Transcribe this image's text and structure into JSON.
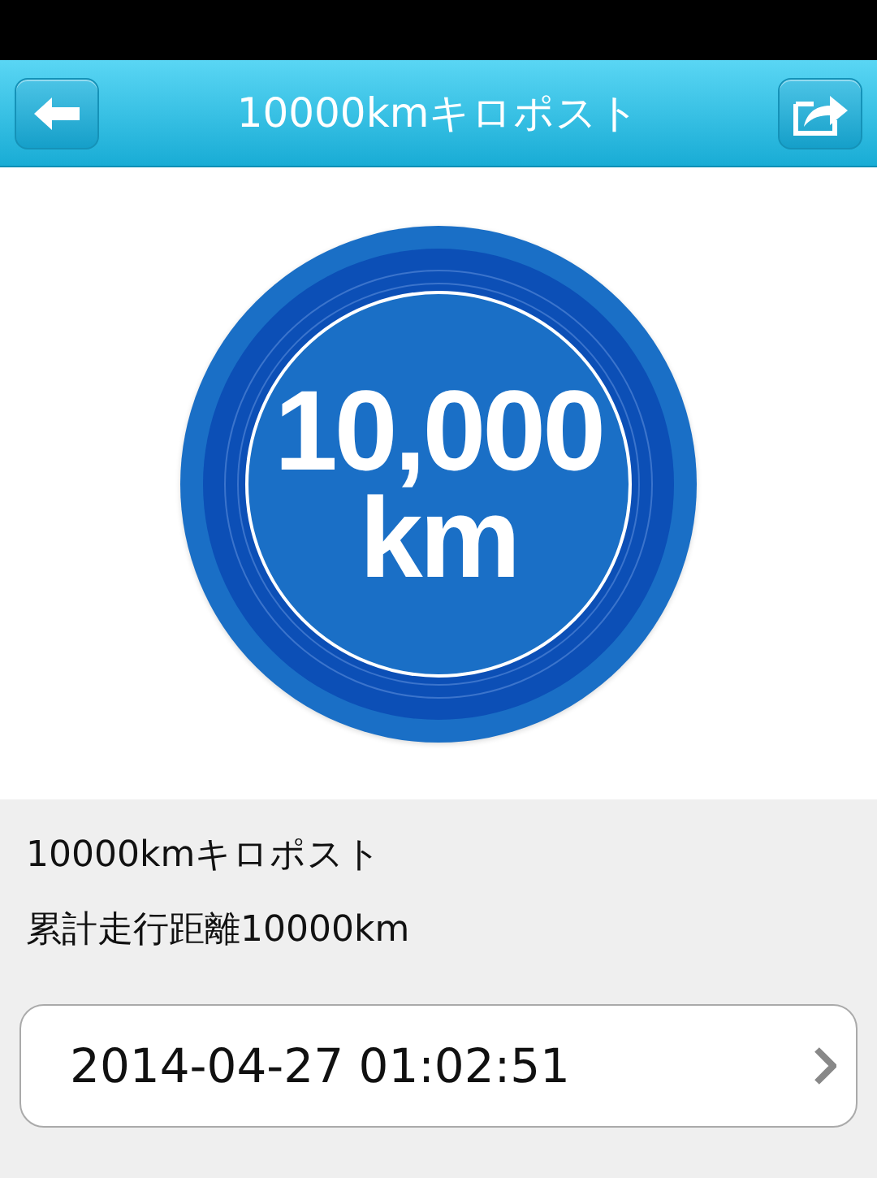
{
  "header": {
    "title": "10000kmキロポスト"
  },
  "badge": {
    "value": "10,000",
    "unit": "km"
  },
  "details": {
    "title": "10000kmキロポスト",
    "description": "累計走行距離10000km"
  },
  "date_row": {
    "label": "2014-04-27 01:02:51"
  }
}
